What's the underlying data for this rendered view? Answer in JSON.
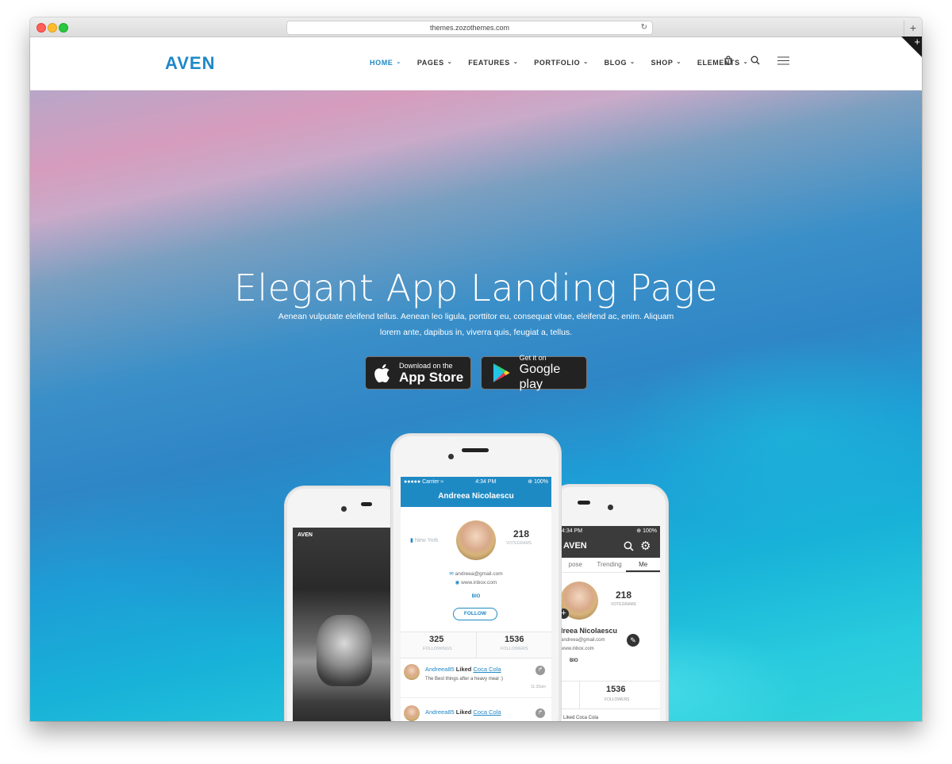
{
  "browser": {
    "url": "themes.zozothemes.com",
    "new_tab": "+",
    "corner_plus": "+"
  },
  "header": {
    "logo": "AVEN",
    "nav": [
      {
        "label": "HOME",
        "active": true
      },
      {
        "label": "PAGES"
      },
      {
        "label": "FEATURES"
      },
      {
        "label": "PORTFOLIO"
      },
      {
        "label": "BLOG"
      },
      {
        "label": "SHOP"
      },
      {
        "label": "ELEMENTS"
      }
    ],
    "caret": "⌄",
    "icons": [
      "cart-icon",
      "search-icon",
      "menu-icon"
    ]
  },
  "hero": {
    "title": "Elegant App Landing Page",
    "text": "Aenean vulputate eleifend tellus. Aenean leo ligula, porttitor eu, consequat vitae, eleifend ac, enim. Aliquam lorem ante, dapibus in, viverra quis, feugiat a, tellus.",
    "appstore": {
      "small": "Download on the",
      "big": "App Store"
    },
    "googleplay": {
      "small": "Get it on",
      "big": "Google play"
    }
  },
  "phone_left": {
    "label": "AVEN"
  },
  "phone_center": {
    "carrier": "●●●●● Carrier ≈",
    "time": "4:34 PM",
    "battery": "⊕ 100%",
    "name": "Andreea Nicolaescu",
    "location": "New York",
    "votegrams": "218",
    "votegrams_label": "VOTEGRAMS",
    "email": "andreea@gmail.com",
    "web": "www.inbox.com",
    "bio": "BIO",
    "follow": "FOLLOW",
    "followings": "325",
    "followings_label": "FOLLOWINGS",
    "followers": "1536",
    "followers_label": "FOLLOWERS",
    "feed": [
      {
        "user": "Andreea85",
        "action": "Liked",
        "brand": "Coca Cola",
        "text": "The Best things after a heavy meal :)",
        "time": "11:30am"
      },
      {
        "user": "Andreea85",
        "action": "Liked",
        "brand": "Coca Cola"
      }
    ]
  },
  "phone_right": {
    "time": "4:34 PM",
    "battery": "⊕ 100%",
    "logo": "AVEN",
    "tabs": [
      "pose",
      "Trending",
      "Me"
    ],
    "votegrams": "218",
    "votegrams_label": "VOTEGRAMS",
    "name": "dreea Nicolaescu",
    "email": "andreea@gmail.com",
    "web": "www.inbox.com",
    "bio": "BIO",
    "followers": "1536",
    "followers_label": "FOLLOWERS",
    "partial": "Liked Coca Cola"
  },
  "colors": {
    "accent": "#1e88c6",
    "dark_button": "#222222"
  }
}
